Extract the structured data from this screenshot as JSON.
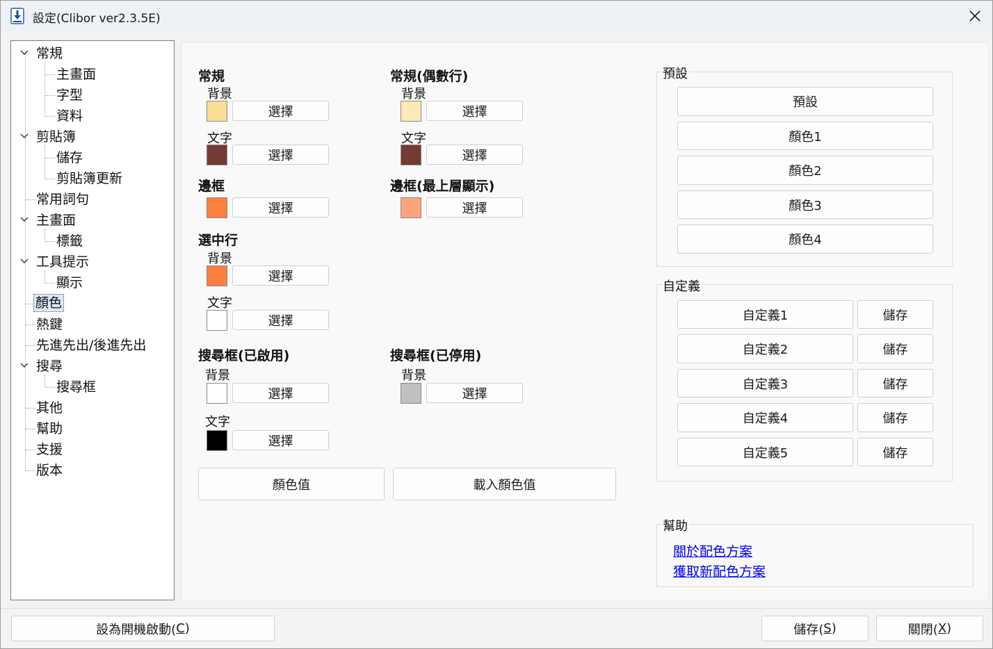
{
  "window": {
    "title": "設定(Clibor ver2.3.5E)"
  },
  "tree": {
    "items": [
      {
        "label": "常規",
        "level": 0,
        "expanded": true
      },
      {
        "label": "主畫面",
        "level": 1
      },
      {
        "label": "字型",
        "level": 1
      },
      {
        "label": "資料",
        "level": 1
      },
      {
        "label": "剪貼簿",
        "level": 0,
        "expanded": true
      },
      {
        "label": "儲存",
        "level": 1
      },
      {
        "label": "剪貼簿更新",
        "level": 1
      },
      {
        "label": "常用詞句",
        "level": 0
      },
      {
        "label": "主畫面",
        "level": 0,
        "expanded": true
      },
      {
        "label": "標籤",
        "level": 1
      },
      {
        "label": "工具提示",
        "level": 0,
        "expanded": true
      },
      {
        "label": "顯示",
        "level": 1
      },
      {
        "label": "顏色",
        "level": 0,
        "selected": true
      },
      {
        "label": "熱鍵",
        "level": 0
      },
      {
        "label": "先進先出/後進先出",
        "level": 0
      },
      {
        "label": "搜尋",
        "level": 0,
        "expanded": true
      },
      {
        "label": "搜尋框",
        "level": 1
      },
      {
        "label": "其他",
        "level": 0
      },
      {
        "label": "幫助",
        "level": 0
      },
      {
        "label": "支援",
        "level": 0
      },
      {
        "label": "版本",
        "level": 0
      }
    ]
  },
  "colors": {
    "select_label": "選擇",
    "normal": {
      "title": "常規",
      "bg_label": "背景",
      "bg": "#f8df94",
      "text_label": "文字",
      "text": "#743a33"
    },
    "normal_even": {
      "title": "常規(偶數行)",
      "bg_label": "背景",
      "bg": "#fbeab5",
      "text_label": "文字",
      "text": "#743a33"
    },
    "border": {
      "title": "邊框",
      "color": "#fd7f3d"
    },
    "border_top": {
      "title": "邊框(最上層顯示)",
      "color": "#fda47c"
    },
    "selected_row": {
      "title": "選中行",
      "bg_label": "背景",
      "bg": "#fd7f3d",
      "text_label": "文字",
      "text": "#ffffff"
    },
    "search_enabled": {
      "title": "搜尋框(已啟用)",
      "bg_label": "背景",
      "bg": "#ffffff",
      "text_label": "文字",
      "text": "#000000"
    },
    "search_disabled": {
      "title": "搜尋框(已停用)",
      "bg_label": "背景",
      "bg": "#c0c0c0"
    },
    "color_value_button": "顏色值",
    "load_color_value_button": "載入顏色值"
  },
  "presets": {
    "title": "預設",
    "buttons": [
      "預設",
      "顏色1",
      "顏色2",
      "顏色3",
      "顏色4"
    ]
  },
  "custom": {
    "title": "自定義",
    "save_label": "儲存",
    "items": [
      "自定義1",
      "自定義2",
      "自定義3",
      "自定義4",
      "自定義5"
    ]
  },
  "help": {
    "title": "幫助",
    "links": [
      "關於配色方案",
      "獲取新配色方案"
    ]
  },
  "footer": {
    "startup_button": "設為開機啟動(",
    "startup_key": "C",
    "save_button": "儲存(",
    "save_key": "S",
    "close_button": "關閉(",
    "close_key": "X",
    "close_paren": ")"
  }
}
